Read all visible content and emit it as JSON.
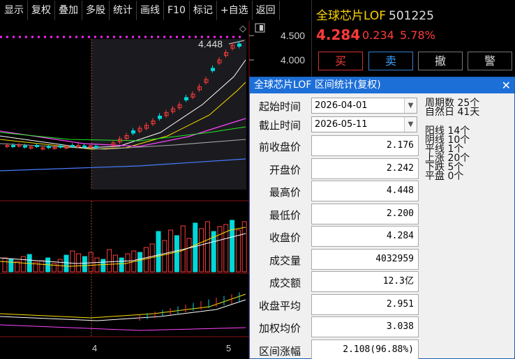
{
  "toolbar": [
    "显示",
    "复权",
    "叠加",
    "多股",
    "统计",
    "画线",
    "F10",
    "标记",
    "+自选",
    "返回"
  ],
  "quote": {
    "name": "全球芯片LOF",
    "code": "501225",
    "price": "4.284",
    "change": "0.234",
    "change_pct": "5.78%",
    "buttons": {
      "buy": "买",
      "sell": "卖",
      "cancel": "撤",
      "alert": "警"
    }
  },
  "chart": {
    "price_ticks": [
      "4.500",
      "4.000"
    ],
    "high_label": "4.448",
    "date_ticks": [
      "4",
      "5"
    ],
    "colors": {
      "up": "#ff3b3b",
      "down": "#00d8d8",
      "ma5": "#ffffff",
      "ma10": "#ffe000",
      "ma20": "#ff44ff",
      "ma60": "#22ee22",
      "ma120": "#4a7cff",
      "dotted": "#ff22ff"
    }
  },
  "dialog": {
    "title": "全球芯片LOF 区间统计(复权)",
    "start_label": "起始时间",
    "start_value": "2026-04-01",
    "end_label": "截止时间",
    "end_value": "2026-05-11",
    "rows": [
      {
        "label": "前收盘价",
        "value": "2.176"
      },
      {
        "label": "开盘价",
        "value": "2.242"
      },
      {
        "label": "最高价",
        "value": "4.448"
      },
      {
        "label": "最低价",
        "value": "2.200"
      },
      {
        "label": "收盘价",
        "value": "4.284"
      },
      {
        "label": "成交量",
        "value": "4032959"
      },
      {
        "label": "成交额",
        "value": "12.3亿"
      },
      {
        "label": "收盘平均",
        "value": "2.951"
      },
      {
        "label": "加权均价",
        "value": "3.038"
      },
      {
        "label": "区间涨幅",
        "value": "2.108(96.88%)"
      }
    ],
    "side": {
      "period_days": "周期数  25个",
      "natural_days": "自然日  41天",
      "yang": "阳线  14个",
      "yin": "阴线  10个",
      "flat": "平线  1个",
      "up": "上涨  20个",
      "down": "下跌  5个",
      "even": "平盘  0个"
    }
  }
}
